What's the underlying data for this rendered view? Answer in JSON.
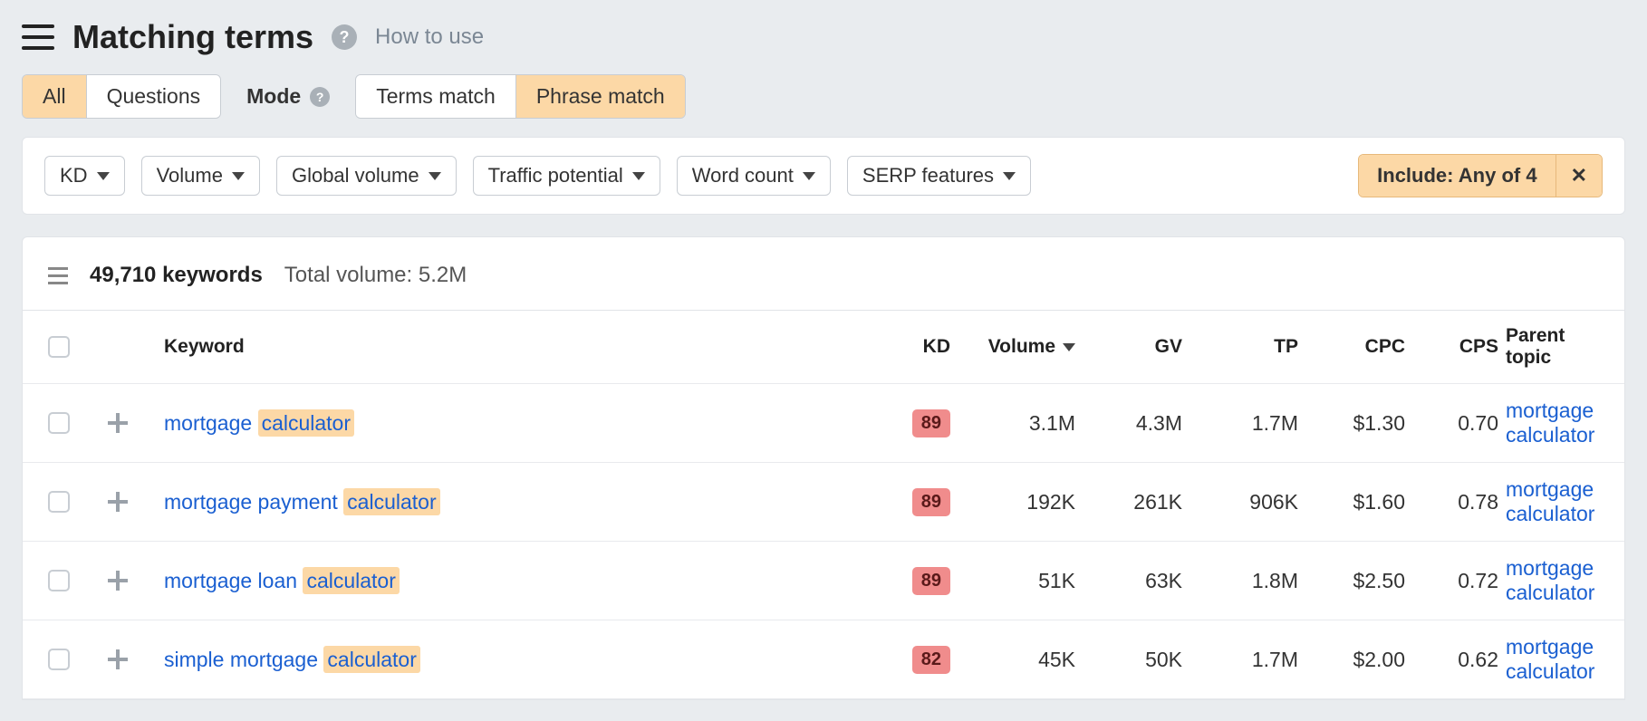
{
  "header": {
    "title": "Matching terms",
    "howToUse": "How to use"
  },
  "tabs": {
    "all": "All",
    "questions": "Questions",
    "modeLabel": "Mode",
    "termsMatch": "Terms match",
    "phraseMatch": "Phrase match"
  },
  "filters": {
    "kd": "KD",
    "volume": "Volume",
    "globalVolume": "Global volume",
    "trafficPotential": "Traffic potential",
    "wordCount": "Word count",
    "serpFeatures": "SERP features",
    "include": "Include: Any of 4"
  },
  "summary": {
    "countLabel": "49,710 keywords",
    "totalVolume": "Total volume: 5.2M"
  },
  "columns": {
    "keyword": "Keyword",
    "kd": "KD",
    "volume": "Volume",
    "gv": "GV",
    "tp": "TP",
    "cpc": "CPC",
    "cps": "CPS",
    "parent": "Parent topic"
  },
  "highlight": "calculator",
  "rows": [
    {
      "keyword": "mortgage calculator",
      "kd": "89",
      "volume": "3.1M",
      "gv": "4.3M",
      "tp": "1.7M",
      "cpc": "$1.30",
      "cps": "0.70",
      "parent": "mortgage calculator"
    },
    {
      "keyword": "mortgage payment calculator",
      "kd": "89",
      "volume": "192K",
      "gv": "261K",
      "tp": "906K",
      "cpc": "$1.60",
      "cps": "0.78",
      "parent": "mortgage calculator"
    },
    {
      "keyword": "mortgage loan calculator",
      "kd": "89",
      "volume": "51K",
      "gv": "63K",
      "tp": "1.8M",
      "cpc": "$2.50",
      "cps": "0.72",
      "parent": "mortgage calculator"
    },
    {
      "keyword": "simple mortgage calculator",
      "kd": "82",
      "volume": "45K",
      "gv": "50K",
      "tp": "1.7M",
      "cpc": "$2.00",
      "cps": "0.62",
      "parent": "mortgage calculator"
    }
  ]
}
